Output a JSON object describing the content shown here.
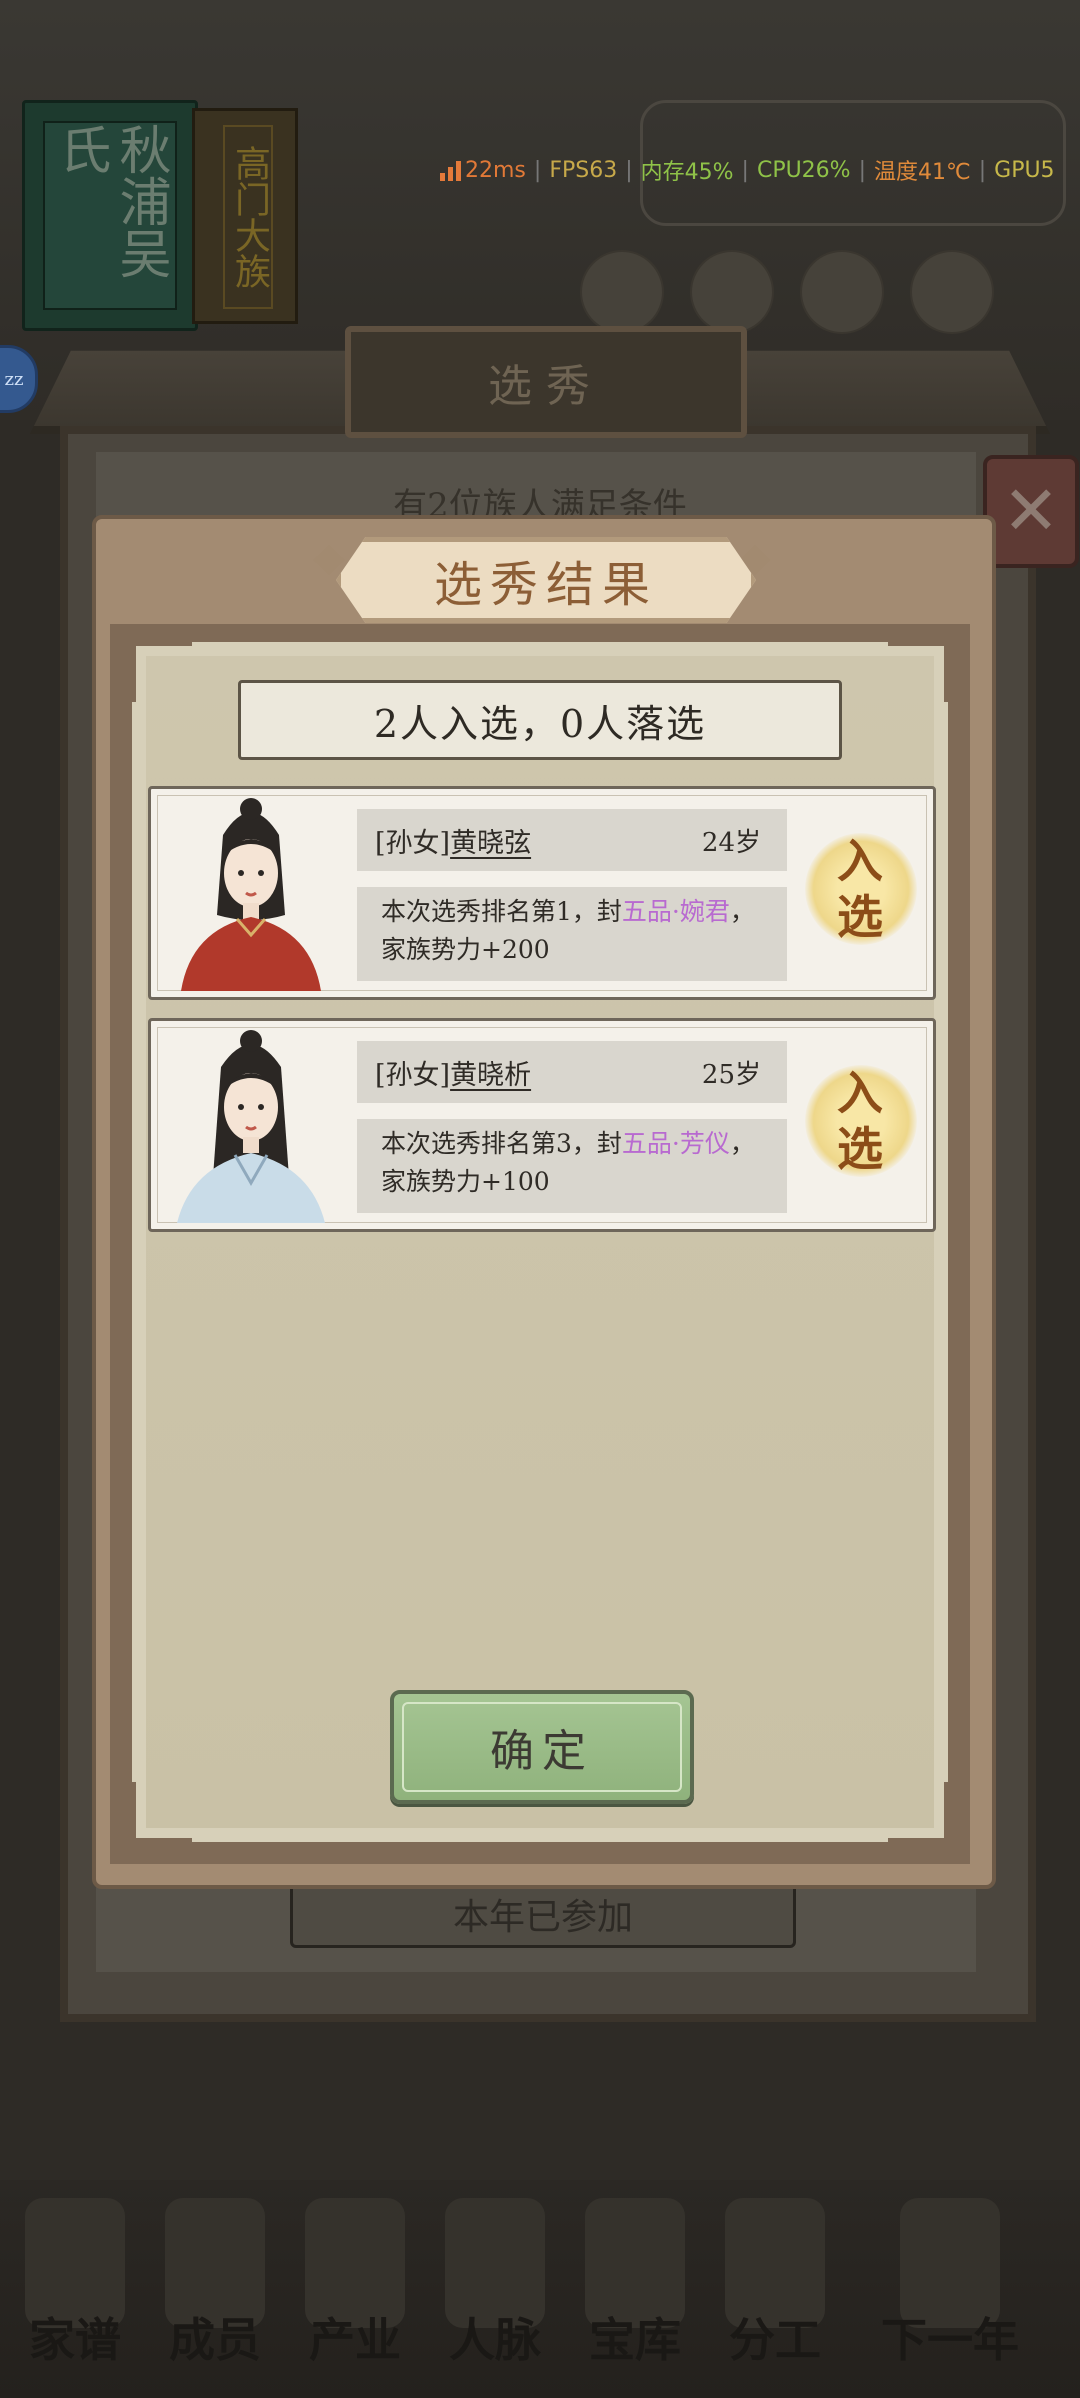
{
  "background": {
    "book": {
      "spine_title": "秋浦吴氏",
      "side_text": "高门大族"
    },
    "outer_panel": {
      "title": "选秀",
      "condition": "有2位族人满足条件",
      "footer_status": "本年已参加",
      "close_label": "✕"
    },
    "side_badge": "zz",
    "nav": [
      "家谱",
      "成员",
      "产业",
      "人脉",
      "宝库",
      "分工",
      "下一年"
    ]
  },
  "perf": {
    "ping": "22ms",
    "fps": "FPS63",
    "memory": "内存45%",
    "cpu": "CPU26%",
    "temp": "温度41℃",
    "gpu": "GPU5"
  },
  "colors": {
    "ping": "#e27937",
    "fps": "#c7a94a",
    "memory": "#8fc248",
    "cpu": "#8fc248",
    "temp": "#e08a3a",
    "gpu": "#c7b84a",
    "highlight_rank": "#b86ad0",
    "confirm_green": "#9bbd88"
  },
  "modal": {
    "title": "选秀结果",
    "summary": "2人入选，0人落选",
    "confirm_label": "确定",
    "results": [
      {
        "relation": "[孙女]",
        "name": "黄晓弦",
        "age": "24岁",
        "desc_prefix": "本次选秀排名第1，封",
        "rank": "五品·婉君",
        "desc_suffix": "，家族势力+200",
        "status": "入选",
        "portrait": "red-robe-lady-portrait"
      },
      {
        "relation": "[孙女]",
        "name": "黄晓析",
        "age": "25岁",
        "desc_prefix": "本次选秀排名第3，封",
        "rank": "五品·芳仪",
        "desc_suffix": "，家族势力+100",
        "status": "入选",
        "portrait": "blue-robe-lady-portrait"
      }
    ]
  }
}
